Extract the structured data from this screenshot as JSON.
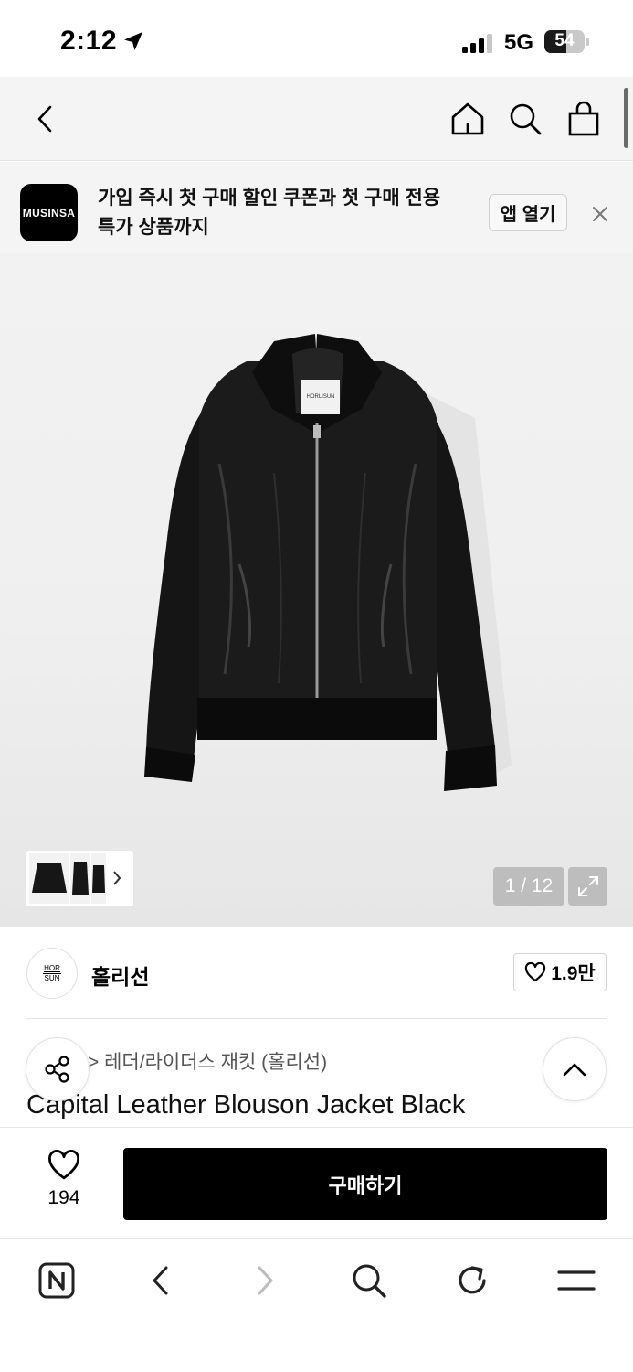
{
  "status_bar": {
    "time": "2:12",
    "network": "5G",
    "battery": "54",
    "battery_level": 0.54
  },
  "nav": {
    "icons": [
      "back-icon",
      "home-icon",
      "search-icon",
      "shopping-bag-icon"
    ]
  },
  "banner": {
    "logo_text": "MUSINSA",
    "message": "가입 즉시 첫 구매 할인 쿠폰과 첫 구매 전용 특가 상품까지",
    "open_app_label": "앱 열기"
  },
  "gallery": {
    "counter": "1 / 12",
    "tag_text": "HORLISUN"
  },
  "brand": {
    "avatar_top": "HOR",
    "avatar_bottom": "SUN",
    "name": "홀리선",
    "likes": "1.9만"
  },
  "product": {
    "breadcrumb": "> 레더/라이더스 재킷 (홀리선)",
    "title": "Capital Leather Blouson Jacket Black"
  },
  "purchase": {
    "wish_count": "194",
    "buy_label": "구매하기"
  },
  "colors": {
    "accent": "#000000",
    "header_bg": "#f4f4f4"
  }
}
